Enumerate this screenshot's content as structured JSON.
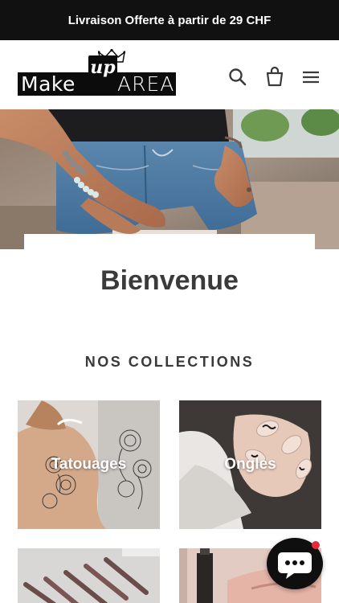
{
  "announcement": {
    "text": "Livraison Offerte à partir de 29 CHF"
  },
  "header": {
    "logo": {
      "left": "Make",
      "middle": "up",
      "right": "AREA"
    },
    "icons": [
      "search-icon",
      "cart-icon",
      "menu-icon"
    ]
  },
  "hero": {
    "image": "hands-on-denim-shorts-with-bracelets"
  },
  "welcome": {
    "title": "Bienvenue"
  },
  "collections": {
    "title": "NOS COLLECTIONS",
    "items": [
      {
        "label": "Tatouages"
      },
      {
        "label": "Ongles"
      },
      {
        "label": ""
      },
      {
        "label": ""
      }
    ]
  },
  "chat": {
    "icon": "chat-bubble-icon",
    "badge_color": "#e8283a"
  },
  "colors": {
    "topbar": "#111111",
    "text": "#3a3a3a",
    "accent": "#e8283a"
  }
}
